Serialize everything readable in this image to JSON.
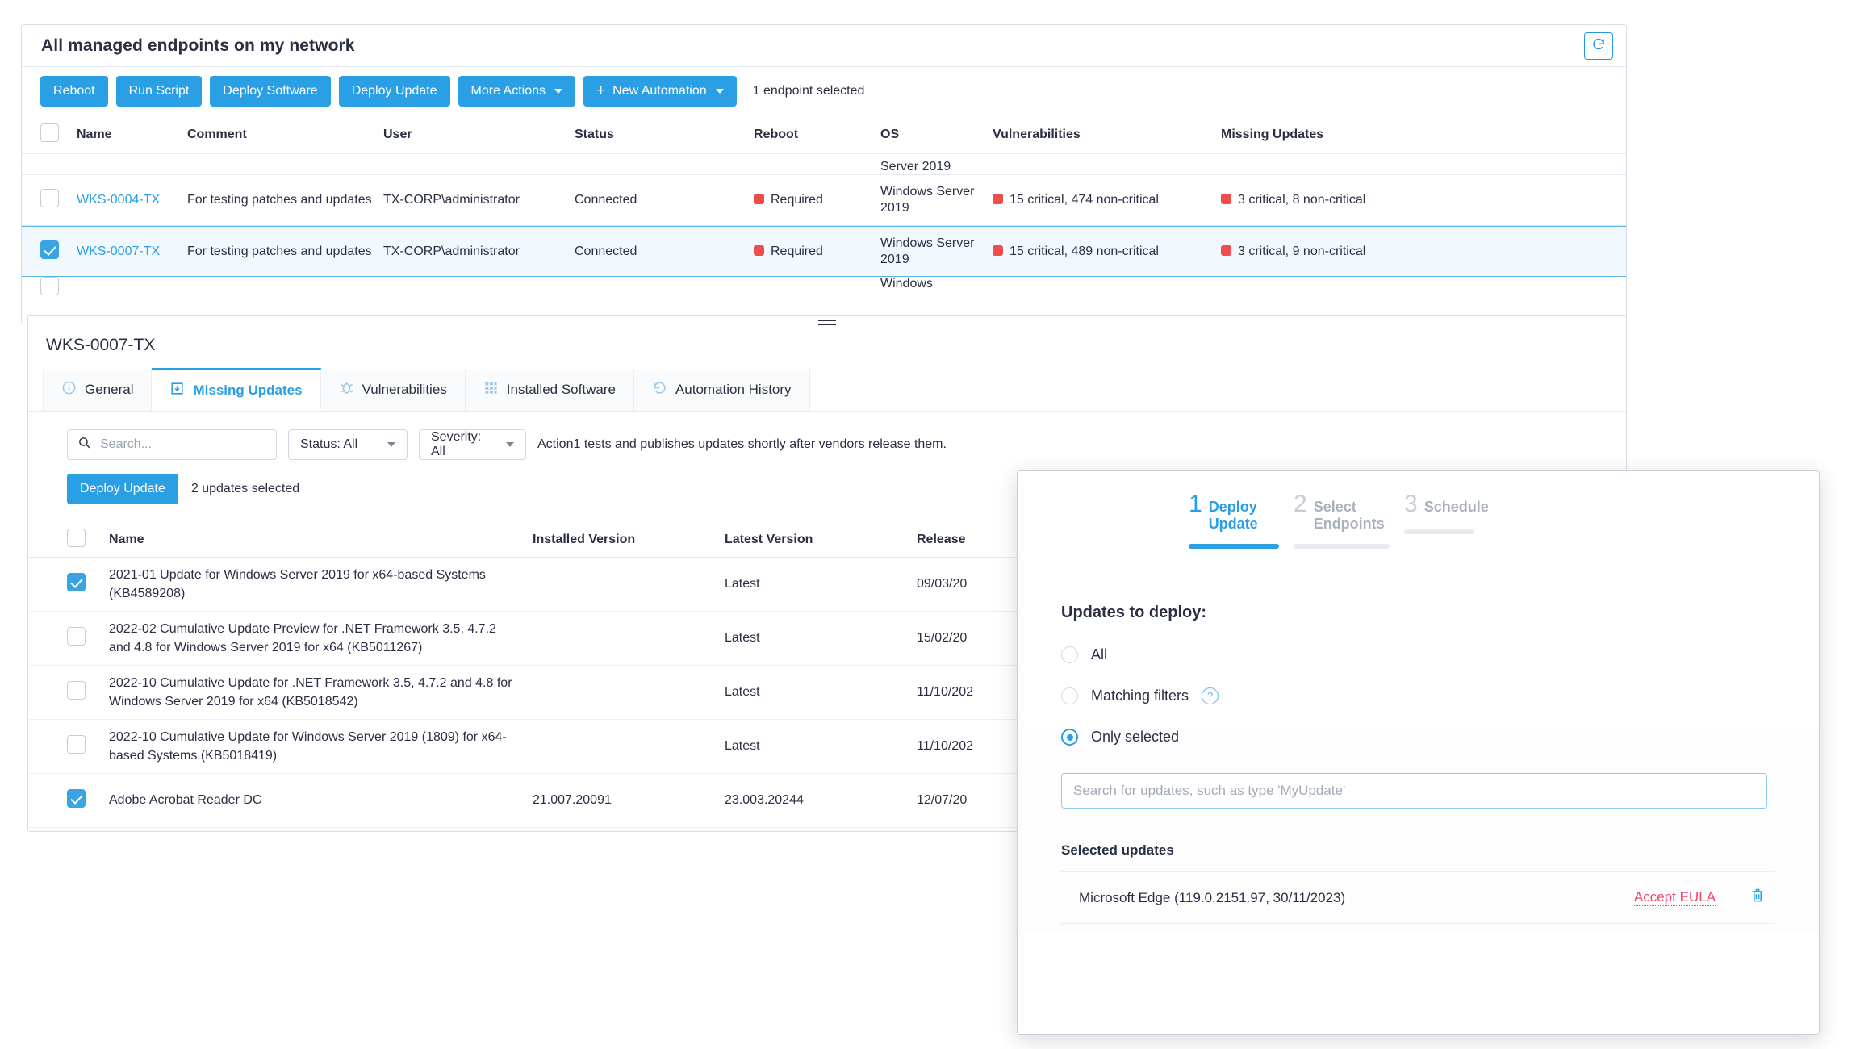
{
  "endpoints_panel": {
    "title": "All managed endpoints on my network",
    "refresh_icon": "refresh-icon",
    "toolbar": {
      "reboot": "Reboot",
      "run_script": "Run Script",
      "deploy_software": "Deploy Software",
      "deploy_update": "Deploy Update",
      "more_actions": "More Actions",
      "new_automation": "New Automation",
      "new_automation_plus": "+",
      "status": "1 endpoint selected"
    },
    "columns": [
      "Name",
      "Comment",
      "User",
      "Status",
      "Reboot",
      "OS",
      "Vulnerabilities",
      "Missing Updates"
    ],
    "partial_top_os": "Server 2019",
    "rows": [
      {
        "checked": false,
        "name": "WKS-0004-TX",
        "comment": "For testing patches and updates",
        "user": "TX-CORP\\administrator",
        "status": "Connected",
        "reboot": "Required",
        "os": "Windows Server 2019",
        "vulnerabilities": "15 critical,  474 non-critical",
        "missing_updates": "3 critical,  8 non-critical"
      },
      {
        "checked": true,
        "name": "WKS-0007-TX",
        "comment": "For testing patches and updates",
        "user": "TX-CORP\\administrator",
        "status": "Connected",
        "reboot": "Required",
        "os": "Windows Server 2019",
        "vulnerabilities": "15 critical,  489 non-critical",
        "missing_updates": "3 critical,  9 non-critical"
      }
    ],
    "partial_bottom_os": "Windows"
  },
  "detail_panel": {
    "title": "WKS-0007-TX",
    "tabs": [
      {
        "label": "General",
        "icon": "info-icon",
        "active": false
      },
      {
        "label": "Missing Updates",
        "icon": "download-box-icon",
        "active": true
      },
      {
        "label": "Vulnerabilities",
        "icon": "bug-icon",
        "active": false
      },
      {
        "label": "Installed Software",
        "icon": "grid-icon",
        "active": false
      },
      {
        "label": "Automation History",
        "icon": "history-icon",
        "active": false
      }
    ],
    "filters": {
      "search_placeholder": "Search...",
      "search_value": "",
      "search_icon": "search-icon",
      "status_filter": "Status: All",
      "severity_filter": "Severity: All",
      "hint": "Action1 tests and publishes updates shortly after vendors release them."
    },
    "deploy": {
      "button": "Deploy Update",
      "count": "2 updates selected"
    },
    "table": {
      "columns": [
        "Name",
        "Installed Version",
        "Latest Version",
        "Release"
      ],
      "rows": [
        {
          "checked": true,
          "name": "2021-01 Update for Windows Server 2019 for x64-based Systems (KB4589208)",
          "installed_version": "",
          "latest_version": "Latest",
          "release": "09/03/20"
        },
        {
          "checked": false,
          "name": "2022-02 Cumulative Update Preview for .NET Framework 3.5, 4.7.2 and 4.8 for Windows Server 2019 for x64 (KB5011267)",
          "installed_version": "",
          "latest_version": "Latest",
          "release": "15/02/20"
        },
        {
          "checked": false,
          "name": "2022-10 Cumulative Update for .NET Framework 3.5, 4.7.2 and 4.8 for Windows Server 2019 for x64 (KB5018542)",
          "installed_version": "",
          "latest_version": "Latest",
          "release": "11/10/202"
        },
        {
          "checked": false,
          "name": "2022-10 Cumulative Update for Windows Server 2019 (1809) for x64-based Systems (KB5018419)",
          "installed_version": "",
          "latest_version": "Latest",
          "release": "11/10/202"
        },
        {
          "checked": true,
          "name": "Adobe Acrobat Reader DC",
          "installed_version": "21.007.20091",
          "latest_version": "23.003.20244",
          "release": "12/07/20"
        }
      ]
    }
  },
  "modal": {
    "steps": [
      {
        "num": "1",
        "label": "Deploy Update",
        "active": true
      },
      {
        "num": "2",
        "label": "Select Endpoints",
        "active": false
      },
      {
        "num": "3",
        "label": "Schedule",
        "active": false
      }
    ],
    "heading": "Updates to deploy:",
    "options": [
      {
        "label": "All",
        "selected": false,
        "help": false
      },
      {
        "label": "Matching filters",
        "selected": false,
        "help": true,
        "help_icon": "question-icon"
      },
      {
        "label": "Only selected",
        "selected": true,
        "help": false
      }
    ],
    "search_placeholder": "Search for updates, such as type 'MyUpdate'",
    "search_value": "",
    "selected_updates_title": "Selected updates",
    "selected_updates": [
      {
        "name": "Microsoft Edge (119.0.2151.97, 30/11/2023)",
        "eula": "Accept EULA",
        "delete_icon": "trash-icon"
      }
    ]
  },
  "colors": {
    "accent": "#2b9fe3",
    "critical": "#ef4d4d",
    "eula": "#f2456a",
    "text": "#2b2f44"
  }
}
